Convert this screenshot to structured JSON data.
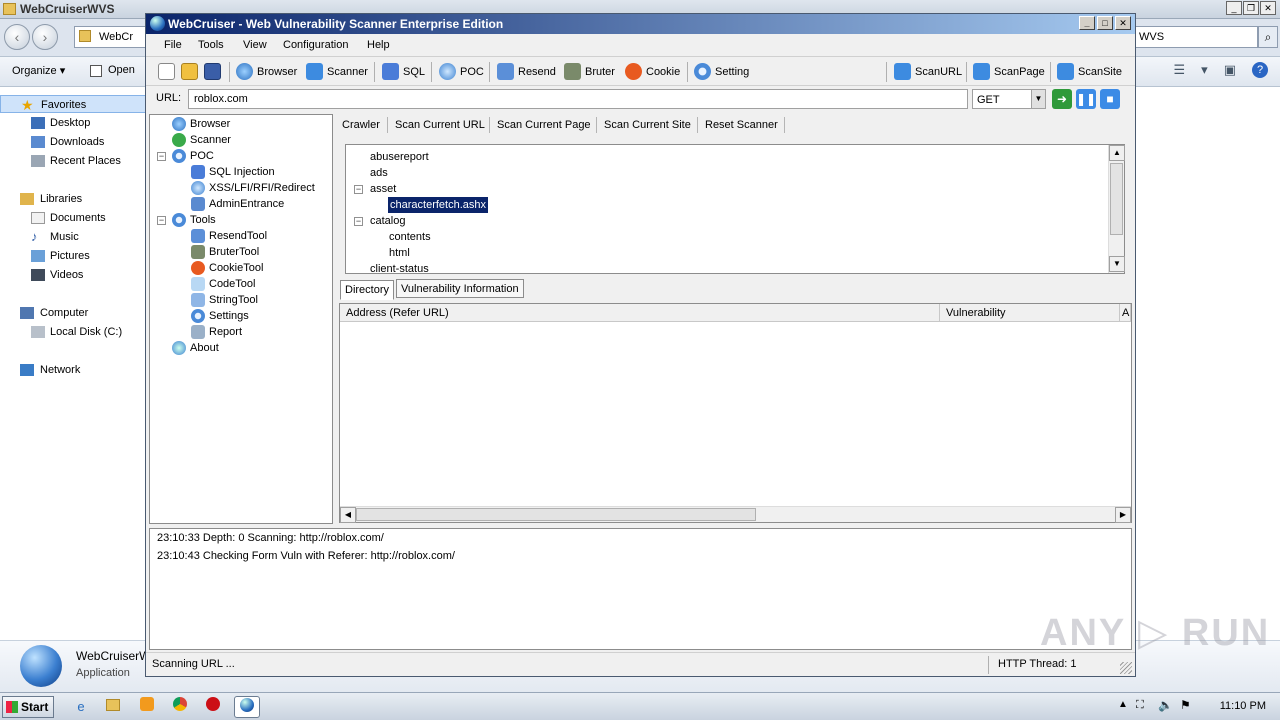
{
  "explorer": {
    "title": "WebCruiserWVS",
    "breadcrumb": "WebCr",
    "search_value": "WVS",
    "commands": {
      "organize": "Organize",
      "open": "Open"
    },
    "nav": {
      "favorites": "Favorites",
      "desktop": "Desktop",
      "downloads": "Downloads",
      "recent_places": "Recent Places",
      "libraries": "Libraries",
      "documents": "Documents",
      "music": "Music",
      "pictures": "Pictures",
      "videos": "Videos",
      "computer": "Computer",
      "local_disk": "Local Disk (C:)",
      "network": "Network"
    },
    "details": {
      "name": "WebCruiserW",
      "type": "Application"
    }
  },
  "app": {
    "title": "WebCruiser - Web Vulnerability Scanner Enterprise Edition",
    "menu": [
      "File",
      "Tools",
      "View",
      "Configuration",
      "Help"
    ],
    "toolbar": {
      "browser": "Browser",
      "scanner": "Scanner",
      "sql": "SQL",
      "poc": "POC",
      "resend": "Resend",
      "bruter": "Bruter",
      "cookie": "Cookie",
      "setting": "Setting",
      "scan_url": "ScanURL",
      "scan_page": "ScanPage",
      "scan_site": "ScanSite"
    },
    "url_label": "URL:",
    "url_value": "roblox.com",
    "method": "GET",
    "tree": {
      "browser": "Browser",
      "scanner": "Scanner",
      "poc": "POC",
      "sql_injection": "SQL Injection",
      "xss": "XSS/LFI/RFI/Redirect",
      "admin_entrance": "AdminEntrance",
      "tools": "Tools",
      "resend_tool": "ResendTool",
      "bruter_tool": "BruterTool",
      "cookie_tool": "CookieTool",
      "code_tool": "CodeTool",
      "string_tool": "StringTool",
      "settings": "Settings",
      "report": "Report",
      "about": "About"
    },
    "scan_tabs": {
      "crawler": "Crawler",
      "scan_current_url": "Scan Current URL",
      "scan_current_page": "Scan Current Page",
      "scan_current_site": "Scan Current Site",
      "reset_scanner": "Reset Scanner"
    },
    "directory": {
      "abusereport": "abusereport",
      "ads": "ads",
      "asset": "asset",
      "characterfetch": "characterfetch.ashx",
      "catalog": "catalog",
      "contents": "contents",
      "html": "html",
      "client_status": "client-status"
    },
    "bottom_tabs": {
      "directory": "Directory",
      "vuln_info": "Vulnerability Information"
    },
    "vuln_columns": {
      "address": "Address (Refer URL)",
      "vulnerability": "Vulnerability",
      "extra": "A"
    },
    "log": [
      "23:10:33 Depth: 0  Scanning: http://roblox.com/",
      "23:10:43 Checking Form Vuln with Referer: http://roblox.com/"
    ],
    "status": {
      "left": "Scanning URL ...",
      "threads": "HTTP Thread: 1"
    }
  },
  "taskbar": {
    "start": "Start",
    "clock": "11:10 PM"
  },
  "watermark": "ANY RUN"
}
